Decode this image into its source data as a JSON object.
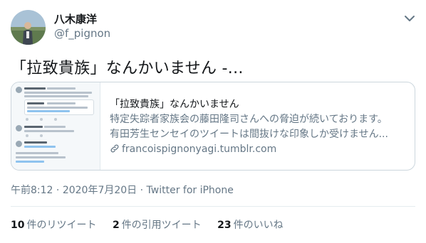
{
  "author": {
    "display_name": "八木康洋",
    "handle": "@f_pignon"
  },
  "tweet": {
    "text": "「拉致貴族」なんかいません -..."
  },
  "card": {
    "title": "「拉致貴族」なんかいません",
    "description_line1": "特定失踪者家族会の藤田隆司さんへの脅迫が続いております。",
    "description_line2": "有田芳生センセイのツイートは間抜けな印象しか受けません...",
    "domain": "francoispignonyagi.tumblr.com"
  },
  "meta": {
    "time": "午前8:12",
    "separator": " · ",
    "date": "2020年7月20日",
    "source": "Twitter for iPhone"
  },
  "stats": {
    "retweets_count": "10",
    "retweets_label": "件のリツイート",
    "quotes_count": "2",
    "quotes_label": "件の引用ツイート",
    "likes_count": "23",
    "likes_label": "件のいいね"
  },
  "icons": {
    "caret": "chevron-down-icon",
    "link": "link-icon"
  },
  "colors": {
    "text": "#14171a",
    "secondary": "#657786",
    "border": "#ccd6dd"
  }
}
